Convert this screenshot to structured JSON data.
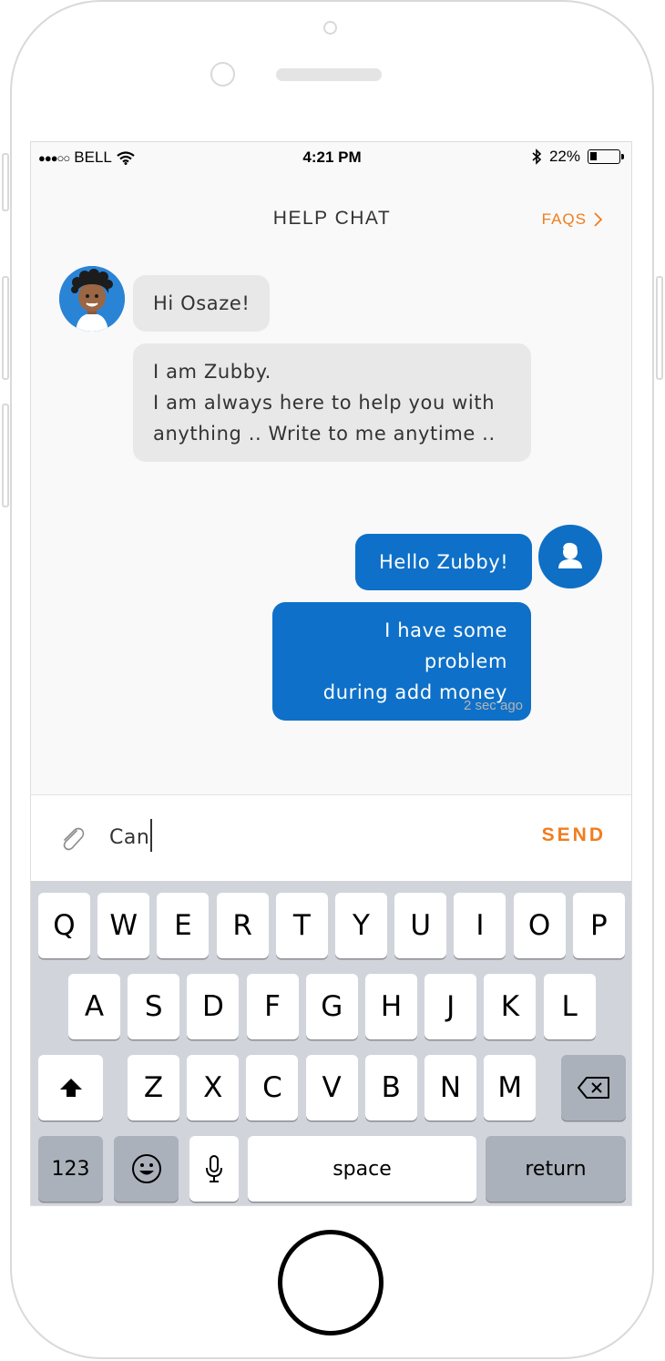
{
  "status_bar": {
    "carrier": "BELL",
    "time": "4:21 PM",
    "battery_percent": "22%",
    "battery_level": 0.22,
    "icons": [
      "signal-dots-icon",
      "wifi-icon",
      "bluetooth-icon",
      "battery-icon"
    ]
  },
  "header": {
    "title": "HELP CHAT",
    "faqs_label": "FAQS"
  },
  "messages": [
    {
      "from": "bot",
      "lines": [
        "Hi Osaze!"
      ]
    },
    {
      "from": "bot",
      "lines": [
        "I am Zubby.",
        "I am always here to help you with",
        "anything .. Write to me anytime .."
      ]
    },
    {
      "from": "user",
      "lines": [
        "Hello Zubby!"
      ]
    },
    {
      "from": "user",
      "lines": [
        "I have some problem",
        "during add money"
      ]
    }
  ],
  "timestamp": "2 sec ago",
  "composer": {
    "input_value": "Can",
    "send_label": "SEND"
  },
  "keyboard": {
    "row1": [
      "Q",
      "W",
      "E",
      "R",
      "T",
      "Y",
      "U",
      "I",
      "O",
      "P"
    ],
    "row2": [
      "A",
      "S",
      "D",
      "F",
      "G",
      "H",
      "J",
      "K",
      "L"
    ],
    "row3": [
      "Z",
      "X",
      "C",
      "V",
      "B",
      "N",
      "M"
    ],
    "numbers_label": "123",
    "space_label": "space",
    "return_label": "return"
  },
  "colors": {
    "accent": "#f07d1e",
    "user_bubble": "#0e70c8",
    "bot_bubble": "#e8e8e8"
  }
}
